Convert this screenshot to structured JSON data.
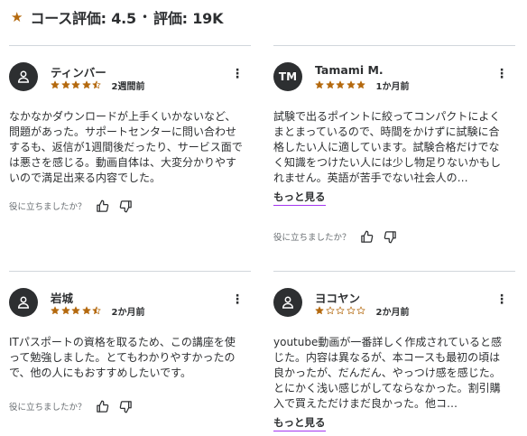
{
  "header": {
    "star_icon": "star-icon",
    "course_rating_label": "コース評価: 4.5",
    "separator": "•",
    "rating_count_label": "評価: 19K"
  },
  "colors": {
    "star": "#b4690e",
    "accent_underline": "#a435f0",
    "text": "#2d2f31",
    "muted": "#6a6f73",
    "divider": "#d1d7dc"
  },
  "helpful_label": "役に立ちましたか？",
  "show_more_label": "もっと見る",
  "reviews": [
    {
      "name": "ティンバー",
      "avatar": "user-icon",
      "rating": 4.5,
      "date": "2週間前",
      "text": "なかなかダウンロードが上手くいかないなど、問題があった。サポートセンターに問い合わせするも、返信が1週間後だったり、サービス面では悪さを感じる。動画自体は、大変分かりやすいので満足出来る内容でした。"
    },
    {
      "name": "Tamami M.",
      "avatar": "TM",
      "rating": 5,
      "date": "1か月前",
      "text": "試験で出るポイントに絞ってコンパクトによくまとまっているので、時間をかけずに試験に合格したい人に適しています。試験合格だけでなく知識をつけたい人には少し物足りないかもしれません。英語が苦手でない社会人の…"
    },
    {
      "name": "岩城",
      "avatar": "user-icon",
      "rating": 4.5,
      "date": "2か月前",
      "text": "ITパスポートの資格を取るため、この講座を使って勉強しました。とてもわかりやすかったので、他の人にもおすすめしたいです。"
    },
    {
      "name": "ヨコヤン",
      "avatar": "user-icon",
      "rating": 1,
      "date": "2か月前",
      "text": "youtube動画が一番詳しく作成されていると感じた。内容は異なるが、本コースも最初の頃は良かったが、だんだん、やっつけ感を感じた。とにかく浅い感じがしてならなかった。割引購入で買えただけまだ良かった。他コ…"
    }
  ]
}
